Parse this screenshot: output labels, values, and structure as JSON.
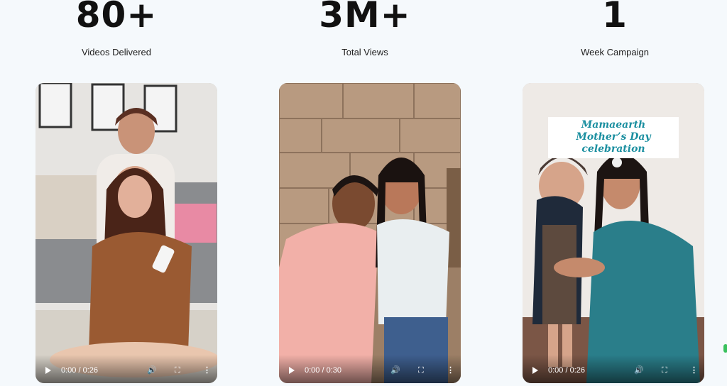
{
  "stats": [
    {
      "number": "80+",
      "label": "Videos Delivered"
    },
    {
      "number": "3M+",
      "label": "Total Views"
    },
    {
      "number": "1",
      "label": "Week Campaign"
    }
  ],
  "videos": [
    {
      "time": "0:00 / 0:26"
    },
    {
      "time": "0:00 / 0:30"
    },
    {
      "time": "0:00 / 0:26",
      "overlay_line1": "Mamaearth",
      "overlay_line2": "Mother’s Day celebration"
    }
  ],
  "icons": {
    "play": "play-icon",
    "volume": "volume-icon",
    "fullscreen": "fullscreen-icon",
    "more": "more-options-icon"
  },
  "colors": {
    "background": "#f5f9fc",
    "overlay_text": "#1b8fa0",
    "stat_text": "#111111"
  }
}
